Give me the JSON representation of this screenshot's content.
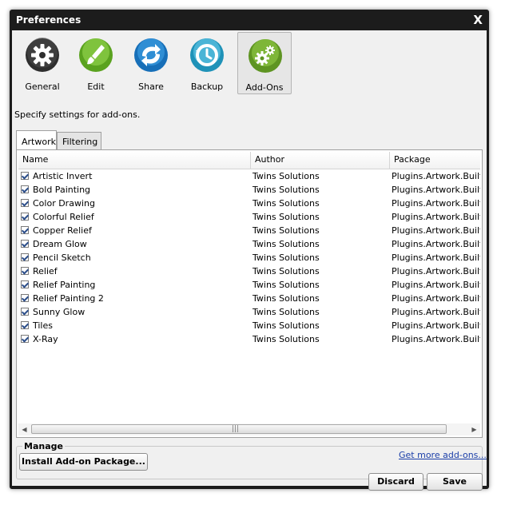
{
  "window": {
    "title": "Preferences",
    "close_label": "X"
  },
  "toolbar": {
    "items": [
      {
        "label": "General",
        "icon": "gear-icon",
        "color": "#3a3a3a"
      },
      {
        "label": "Edit",
        "icon": "brush-icon",
        "color": "#6fb82b"
      },
      {
        "label": "Share",
        "icon": "share-arrows-icon",
        "color": "#1f7fc9"
      },
      {
        "label": "Backup",
        "icon": "backup-clock-icon",
        "color": "#2aa3c9"
      },
      {
        "label": "Add-Ons",
        "icon": "gears-icon",
        "color": "#6ea42a",
        "selected": true
      }
    ]
  },
  "description": "Specify settings for add-ons.",
  "tabs": [
    {
      "label": "Artwork",
      "active": true
    },
    {
      "label": "Filtering"
    }
  ],
  "table": {
    "columns": [
      "Name",
      "Author",
      "Package"
    ],
    "rows": [
      {
        "name": "Artistic Invert",
        "author": "Twins Solutions",
        "package": "Plugins.Artwork.Builtin."
      },
      {
        "name": "Bold Painting",
        "author": "Twins Solutions",
        "package": "Plugins.Artwork.Builtin."
      },
      {
        "name": "Color Drawing",
        "author": "Twins Solutions",
        "package": "Plugins.Artwork.Builtin."
      },
      {
        "name": "Colorful Relief",
        "author": "Twins Solutions",
        "package": "Plugins.Artwork.Builtin."
      },
      {
        "name": "Copper Relief",
        "author": "Twins Solutions",
        "package": "Plugins.Artwork.Builtin."
      },
      {
        "name": "Dream Glow",
        "author": "Twins Solutions",
        "package": "Plugins.Artwork.Builtin."
      },
      {
        "name": "Pencil Sketch",
        "author": "Twins Solutions",
        "package": "Plugins.Artwork.Builtin."
      },
      {
        "name": "Relief",
        "author": "Twins Solutions",
        "package": "Plugins.Artwork.Builtin."
      },
      {
        "name": "Relief Painting",
        "author": "Twins Solutions",
        "package": "Plugins.Artwork.Builtin."
      },
      {
        "name": "Relief Painting 2",
        "author": "Twins Solutions",
        "package": "Plugins.Artwork.Builtin."
      },
      {
        "name": "Sunny Glow",
        "author": "Twins Solutions",
        "package": "Plugins.Artwork.Builtin."
      },
      {
        "name": "Tiles",
        "author": "Twins Solutions",
        "package": "Plugins.Artwork.Builtin."
      },
      {
        "name": "X-Ray",
        "author": "Twins Solutions",
        "package": "Plugins.Artwork.Builtin."
      }
    ]
  },
  "manage": {
    "label": "Manage",
    "install_button": "Install Add-on Package...",
    "more_link": "Get more add-ons..."
  },
  "footer": {
    "discard_button": "Discard",
    "save_button": "Save"
  }
}
